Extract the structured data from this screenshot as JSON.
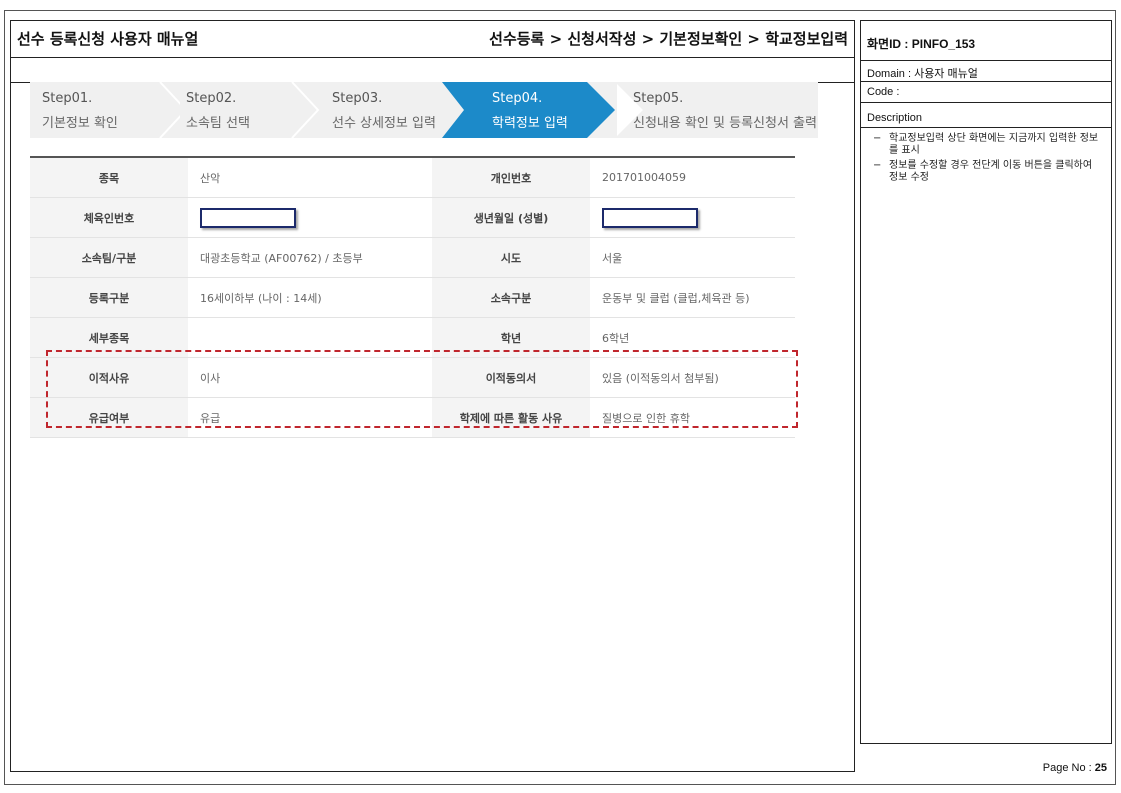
{
  "header": {
    "doc_title": "선수 등록신청 사용자 매뉴얼",
    "breadcrumb": "선수등록 > 신청서작성 > 기본정보확인 > 학교정보입력"
  },
  "steps": [
    {
      "num": "Step01.",
      "label": "기본정보 확인",
      "active": false
    },
    {
      "num": "Step02.",
      "label": "소속팀 선택",
      "active": false
    },
    {
      "num": "Step03.",
      "label": "선수 상세정보 입력",
      "active": false
    },
    {
      "num": "Step04.",
      "label": "학력정보 입력",
      "active": true
    },
    {
      "num": "Step05.",
      "label": "신청내용 확인 및 등록신청서 출력",
      "active": false
    }
  ],
  "table": {
    "rows": [
      {
        "label1": "종목",
        "value1": "산악",
        "label2": "개인번호",
        "value2": "201701004059"
      },
      {
        "label1": "체육인번호",
        "value1": "",
        "label2": "생년월일 (성별)",
        "value2": ""
      },
      {
        "label1": "소속팀/구분",
        "value1": "대광초등학교 (AF00762) / 초등부",
        "label2": "시도",
        "value2": "서울"
      },
      {
        "label1": "등록구분",
        "value1": "16세이하부 (나이 : 14세)",
        "label2": "소속구분",
        "value2": "운동부 및 클럽 (클럽,체육관 등)"
      },
      {
        "label1": "세부종목",
        "value1": "",
        "label2": "학년",
        "value2": "6학년"
      },
      {
        "label1": "이적사유",
        "value1": "이사",
        "label2": "이적동의서",
        "value2": "있음 (이적동의서 첨부됨)"
      },
      {
        "label1": "유급여부",
        "value1": "유급",
        "label2": "학제에 따른 활동 사유",
        "value2": "질병으로 인한 휴학"
      }
    ]
  },
  "side": {
    "screen_id": "화면ID : PINFO_153",
    "domain": "Domain : 사용자 매뉴얼",
    "code": "Code :",
    "description_label": "Description",
    "description_items": [
      "학교정보입력 상단 화면에는 지금까지 입력한 정보를 표시",
      "정보를 수정할 경우 전단계 이동 버튼을 클릭하여 정보 수정"
    ]
  },
  "footer": {
    "page_label": "Page No :",
    "page_number": "25"
  },
  "colors": {
    "active_step": "#1c8ac9",
    "step_bg": "#f0f0f0",
    "highlight_border": "#c0262d",
    "masked_border": "#1c2a6b"
  }
}
